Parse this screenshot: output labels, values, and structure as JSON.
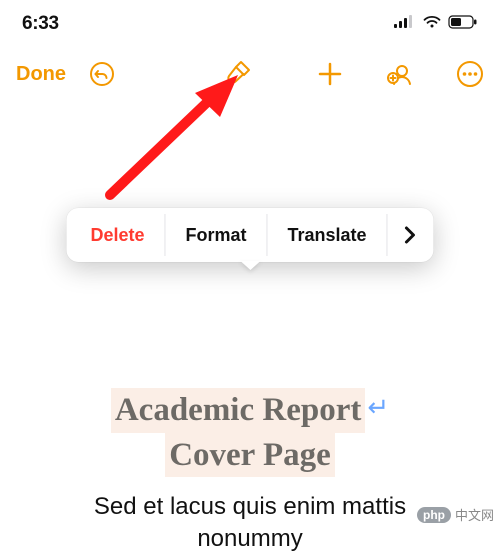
{
  "status": {
    "time": "6:33"
  },
  "toolbar": {
    "done_label": "Done"
  },
  "context_menu": {
    "delete_label": "Delete",
    "format_label": "Format",
    "translate_label": "Translate"
  },
  "document": {
    "title_line1": "Academic Report",
    "title_line2": "Cover Page",
    "subtitle": "Sed et lacus quis enim mattis nonummy"
  },
  "watermark": {
    "pill": "php",
    "text": "中文网"
  },
  "colors": {
    "accent": "#f39800",
    "destructive": "#ff3b30",
    "title_bg": "#fbeee6",
    "title_color": "#6d6a66"
  }
}
